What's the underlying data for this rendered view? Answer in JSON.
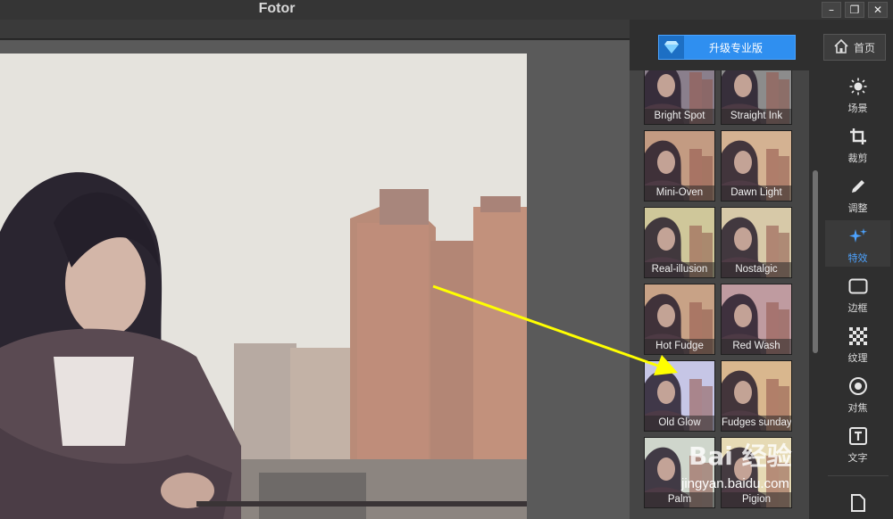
{
  "app": {
    "title": "Fotor"
  },
  "window_controls": {
    "minimize": "–",
    "restore": "❐",
    "close": "✕"
  },
  "header": {
    "upgrade_label": "升级专业版",
    "home_label": "首页"
  },
  "filters": {
    "active_tool": "特效",
    "rows": [
      [
        {
          "name": "Bright Spot",
          "tint": "#8a7f8c"
        },
        {
          "name": "Straight Ink",
          "tint": "#8c8c8c"
        }
      ],
      [
        {
          "name": "Mini-Oven",
          "tint": "#c39b82"
        },
        {
          "name": "Dawn Light",
          "tint": "#d4b292"
        }
      ],
      [
        {
          "name": "Real-illusion",
          "tint": "#cfc79a"
        },
        {
          "name": "Nostalgic",
          "tint": "#d7c9a8"
        }
      ],
      [
        {
          "name": "Hot Fudge",
          "tint": "#c8a286"
        },
        {
          "name": "Red Wash",
          "tint": "#bf9ba0"
        }
      ],
      [
        {
          "name": "Old Glow",
          "tint": "#c6c6e6"
        },
        {
          "name": "Fudges sunday",
          "tint": "#d9b78e"
        }
      ],
      [
        {
          "name": "Palm",
          "tint": "#cfd6cc"
        },
        {
          "name": "Pigion",
          "tint": "#e6dab4"
        }
      ]
    ]
  },
  "tools": [
    {
      "label": "场景",
      "icon": "sun-icon"
    },
    {
      "label": "裁剪",
      "icon": "crop-icon"
    },
    {
      "label": "调整",
      "icon": "pencil-icon"
    },
    {
      "label": "特效",
      "icon": "sparkle-icon"
    },
    {
      "label": "边框",
      "icon": "frame-icon"
    },
    {
      "label": "纹理",
      "icon": "checker-icon"
    },
    {
      "label": "对焦",
      "icon": "focus-icon"
    },
    {
      "label": "文字",
      "icon": "text-icon"
    }
  ],
  "watermark": {
    "logo": "Bai 经验",
    "url": "jingyan.baidu.com"
  },
  "colors": {
    "accent": "#2f8ff0",
    "active_tool": "#4da3ff",
    "arrow": "#ffff00"
  }
}
